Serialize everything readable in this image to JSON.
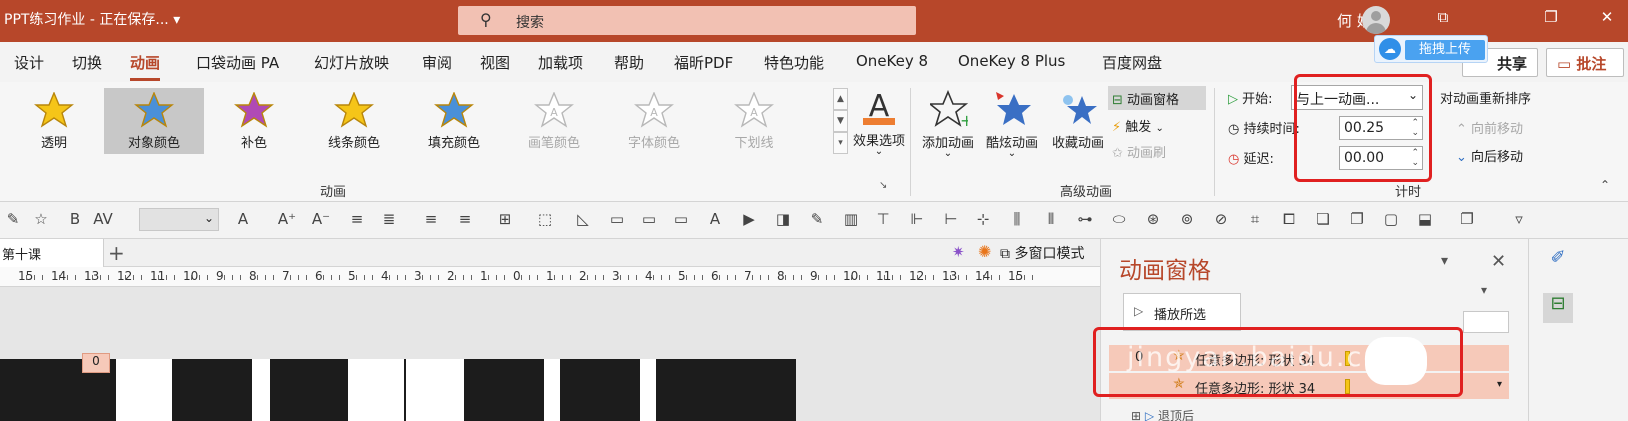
{
  "window": {
    "title": "PPT练习作业  -  正在保存...",
    "title_arrow": "▾",
    "search_placeholder": "搜索",
    "user_name": "何 娇",
    "upload_badge": "拖拽上传",
    "controls": {
      "ribbon_display": "⧉",
      "restore": "❐",
      "close": "✕"
    }
  },
  "tabs": [
    "设计",
    "切换",
    "动画",
    "口袋动画 PA",
    "幻灯片放映",
    "审阅",
    "视图",
    "加载项",
    "帮助",
    "福昕PDF",
    "特色功能",
    "OneKey 8",
    "OneKey 8 Plus",
    "百度网盘"
  ],
  "active_tab": "动画",
  "share_button": "共享",
  "comment_button": "批注",
  "ribbon": {
    "gallery": [
      {
        "label": "透明",
        "fill": "#f5c518",
        "disabled": false
      },
      {
        "label": "对象颜色",
        "fill": "#4a90d9",
        "disabled": false,
        "selected": true
      },
      {
        "label": "补色",
        "fill": "#b04ab5",
        "disabled": false
      },
      {
        "label": "线条颜色",
        "fill": "#f5c518",
        "disabled": false
      },
      {
        "label": "填充颜色",
        "fill": "#4a90d9",
        "disabled": false
      },
      {
        "label": "画笔颜色",
        "fill": "#ffffff",
        "disabled": true
      },
      {
        "label": "字体颜色",
        "fill": "#ffffff",
        "disabled": true
      },
      {
        "label": "下划线",
        "fill": "#ffffff",
        "disabled": true
      }
    ],
    "effect_options": "效果选项",
    "group_animation": "动画",
    "add_animation": "添加动画",
    "cool_animation": "酷炫动画",
    "favorite_animation": "收藏动画",
    "animation_pane_btn": "动画窗格",
    "trigger_btn": "触发",
    "animation_painter": "动画刷",
    "group_advanced": "高级动画",
    "start_label": "开始:",
    "start_value": "与上一动画...",
    "duration_label": "持续时间:",
    "duration_value": "00.25",
    "delay_label": "延迟:",
    "delay_value": "00.00",
    "reorder_title": "对动画重新排序",
    "move_earlier": "向前移动",
    "move_later": "向后移动",
    "group_timing": "计时"
  },
  "slide_tab": "第十课",
  "multi_window": "多窗口模式",
  "ruler_ticks": [
    "15",
    "14",
    "13",
    "12",
    "11",
    "10",
    "9",
    "8",
    "7",
    "6",
    "5",
    "4",
    "3",
    "2",
    "1",
    "0",
    "1",
    "2",
    "3",
    "4",
    "5",
    "6",
    "7",
    "8",
    "9",
    "10",
    "11",
    "12",
    "13",
    "14",
    "15"
  ],
  "slide_marker": "0",
  "anim_pane": {
    "title": "动画窗格",
    "play_button": "播放所选",
    "items": [
      {
        "number": "0",
        "label": "任意多边形: 形状 34"
      },
      {
        "number": "",
        "label": "任意多边形: 形状 34"
      }
    ],
    "next_label": "退顶后"
  },
  "watermark": "jingyan.baidu.com",
  "colors": {
    "accent": "#b7472a",
    "highlight_box": "#e02020",
    "list_highlight": "#f6c9b9"
  }
}
